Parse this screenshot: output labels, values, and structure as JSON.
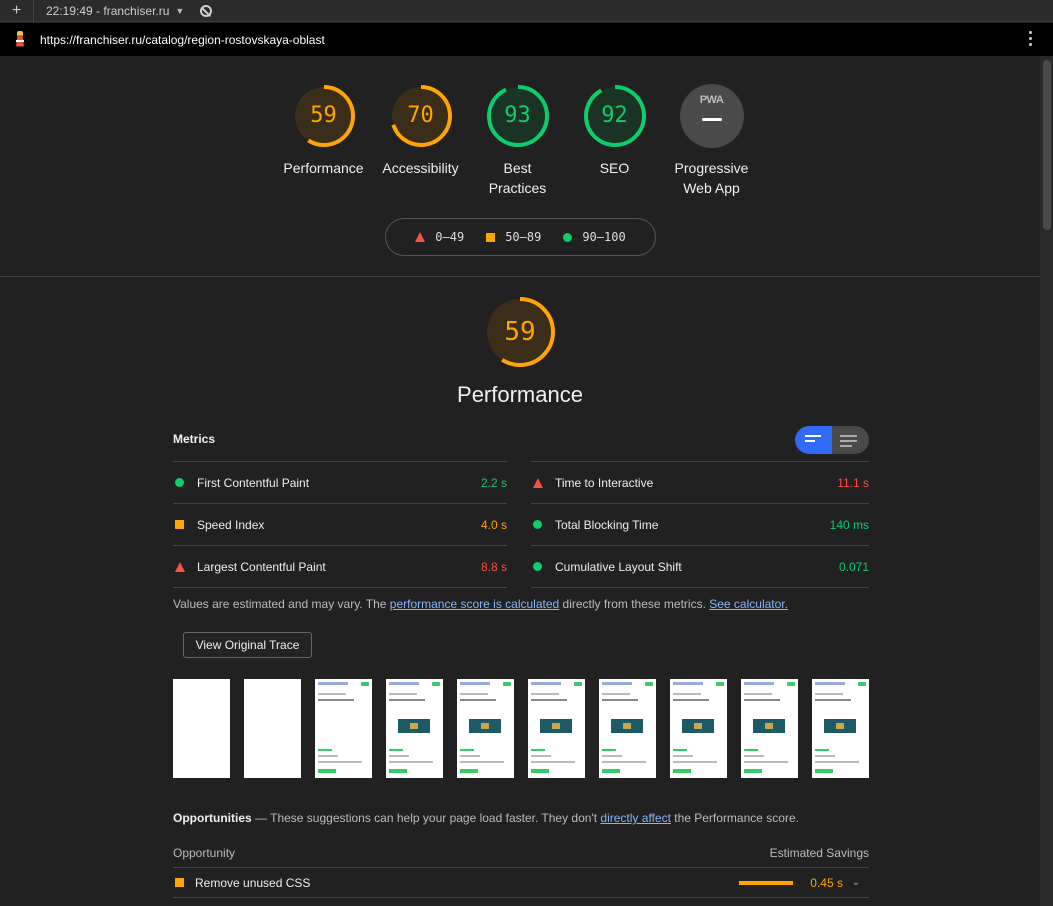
{
  "browser": {
    "session_label": "22:19:49 - franchiser.ru",
    "url": "https://franchiser.ru/catalog/region-rostovskaya-oblast"
  },
  "gauges": [
    {
      "score": "59",
      "label": "Performance",
      "color": "#ffa400",
      "fraction": 0.59
    },
    {
      "score": "70",
      "label": "Accessibility",
      "color": "#ffa400",
      "fraction": 0.7
    },
    {
      "score": "93",
      "label": "Best Practices",
      "color": "#0cce6b",
      "fraction": 0.93
    },
    {
      "score": "92",
      "label": "SEO",
      "color": "#0cce6b",
      "fraction": 0.92
    },
    {
      "score": "",
      "label": "Progressive Web App",
      "color": "#4a4a4a",
      "badge": "PWA"
    }
  ],
  "legend": {
    "fail": "0–49",
    "average": "50–89",
    "pass": "90–100"
  },
  "performance": {
    "score": "59",
    "fraction": 0.59,
    "title": "Performance",
    "metrics_heading": "Metrics",
    "metrics": [
      {
        "name": "First Contentful Paint",
        "value": "2.2 s",
        "rating": "pass"
      },
      {
        "name": "Time to Interactive",
        "value": "11.1 s",
        "rating": "fail"
      },
      {
        "name": "Speed Index",
        "value": "4.0 s",
        "rating": "average"
      },
      {
        "name": "Total Blocking Time",
        "value": "140 ms",
        "rating": "pass"
      },
      {
        "name": "Largest Contentful Paint",
        "value": "8.8 s",
        "rating": "fail"
      },
      {
        "name": "Cumulative Layout Shift",
        "value": "0.071",
        "rating": "pass"
      }
    ],
    "note_prefix": "Values are estimated and may vary. The ",
    "note_link1": "performance score is calculated",
    "note_middle": " directly from these metrics. ",
    "note_link2": "See calculator.",
    "trace_button": "View Original Trace"
  },
  "opportunities": {
    "title": "Opportunities",
    "desc_prefix": " — These suggestions can help your page load faster. They don't ",
    "desc_link": "directly affect",
    "desc_suffix": " the Performance score.",
    "col_opportunity": "Opportunity",
    "col_savings": "Estimated Savings",
    "items": [
      {
        "name": "Remove unused CSS",
        "savings": "0.45 s",
        "rating": "average"
      }
    ]
  },
  "colors": {
    "pass": "#0cce6b",
    "average": "#ffa400",
    "fail": "#ff4e42",
    "toggle_active": "#2f6bf5"
  }
}
